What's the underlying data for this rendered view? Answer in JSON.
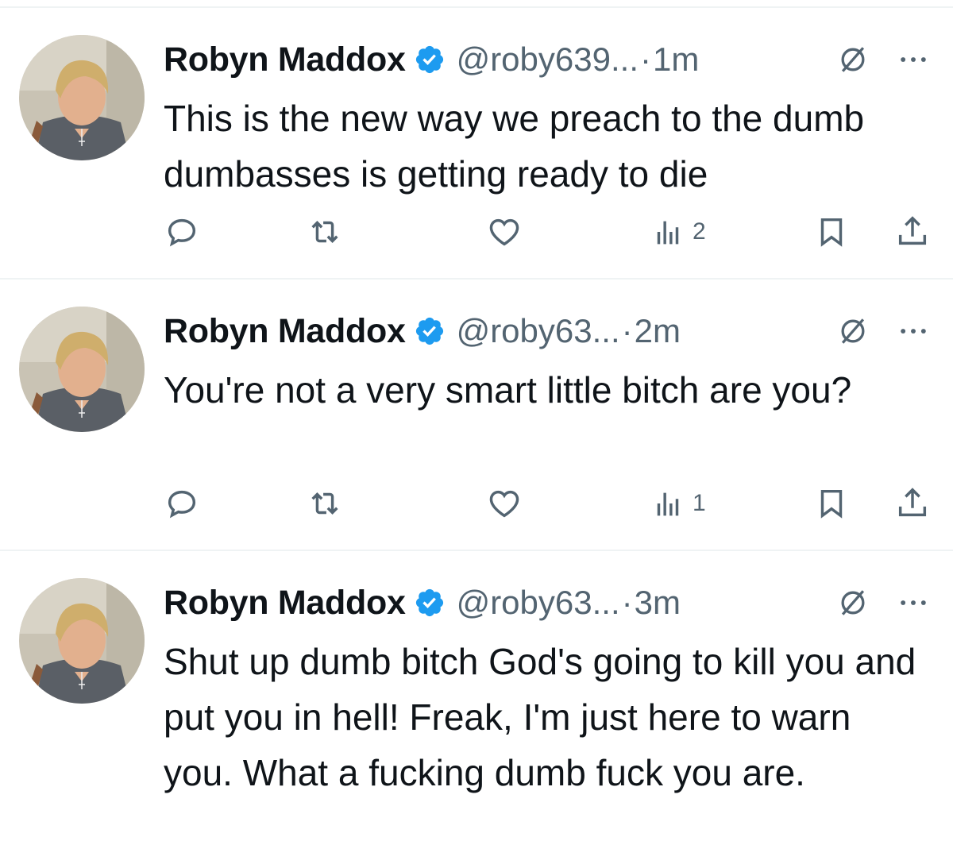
{
  "tweets": [
    {
      "name": "Robyn Maddox",
      "handle": "@roby639...",
      "separator": "·",
      "time": "1m",
      "text": "This is the new way we preach to the dumb dumbasses is getting ready to die",
      "views": "2"
    },
    {
      "name": "Robyn Maddox",
      "handle": "@roby63...",
      "separator": "·",
      "time": "2m",
      "text": "You're not a very smart little bitch are you?",
      "views": "1"
    },
    {
      "name": "Robyn Maddox",
      "handle": "@roby63...",
      "separator": "·",
      "time": "3m",
      "text": "Shut up dumb bitch God's going to kill you and put you in hell! Freak, I'm just here to warn you. What a fucking dumb fuck you are.",
      "views": ""
    }
  ],
  "icons": {
    "verified": "verified-badge-icon",
    "grok": "grok-icon",
    "more": "more-options-icon",
    "reply": "reply-icon",
    "retweet": "retweet-icon",
    "like": "like-icon",
    "views": "views-icon",
    "bookmark": "bookmark-icon",
    "share": "share-icon"
  },
  "colors": {
    "verified": "#1d9bf0",
    "secondary_text": "#536471",
    "primary_text": "#0f1419",
    "divider": "#eff3f4"
  }
}
